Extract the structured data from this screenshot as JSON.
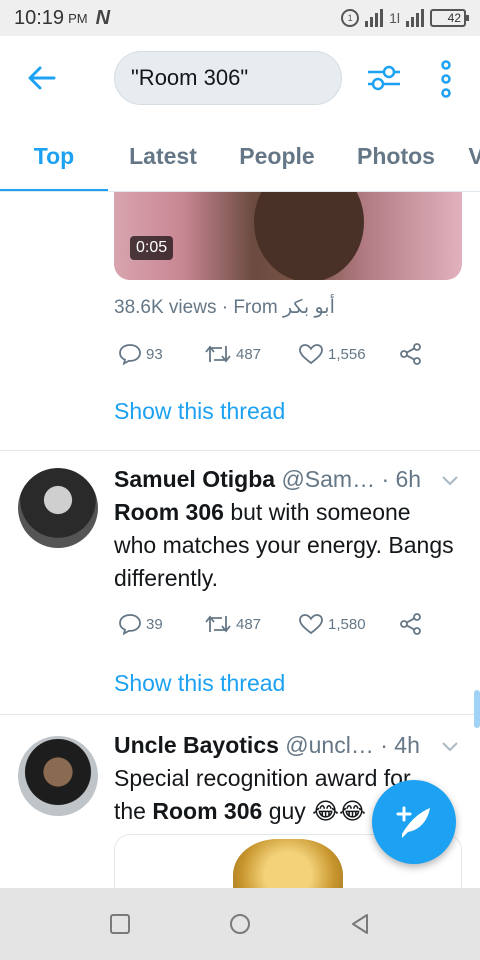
{
  "status_bar": {
    "time": "10:19",
    "ampm": "PM",
    "logo": "N",
    "call_badge": "1",
    "network": "1l",
    "battery": "42"
  },
  "search": {
    "query": "\"Room 306\""
  },
  "tabs": [
    {
      "label": "Top",
      "active": true
    },
    {
      "label": "Latest",
      "active": false
    },
    {
      "label": "People",
      "active": false
    },
    {
      "label": "Photos",
      "active": false
    },
    {
      "label": "V",
      "active": false
    }
  ],
  "feed": {
    "tweet0": {
      "video_duration": "0:05",
      "views": "38.6K views · From أبو بكر",
      "replies": "93",
      "retweets": "487",
      "likes": "1,556",
      "show_thread": "Show this thread"
    },
    "tweet1": {
      "name": "Samuel Otigba",
      "handle": "@Sam…",
      "time": "· 6h",
      "text_bold": "Room 306",
      "text_rest": " but with someone who matches your energy. Bangs differently.",
      "replies": "39",
      "retweets": "487",
      "likes": "1,580",
      "show_thread": "Show this thread"
    },
    "tweet2": {
      "name": "Uncle Bayotics",
      "handle": "@uncl…",
      "time": "· 4h",
      "text_line1": "Special recognition award for",
      "text_pre": "the ",
      "text_bold": "Room 306",
      "text_post": " guy 😂😂"
    }
  },
  "colors": {
    "accent": "#1da1f2",
    "secondary_text": "#657786"
  },
  "icons": [
    "back-arrow-icon",
    "filter-icon",
    "more-vertical-icon",
    "reply-icon",
    "retweet-icon",
    "like-icon",
    "share-icon",
    "chevron-down-icon",
    "compose-icon",
    "nav-square-icon",
    "nav-circle-icon",
    "nav-triangle-icon"
  ]
}
